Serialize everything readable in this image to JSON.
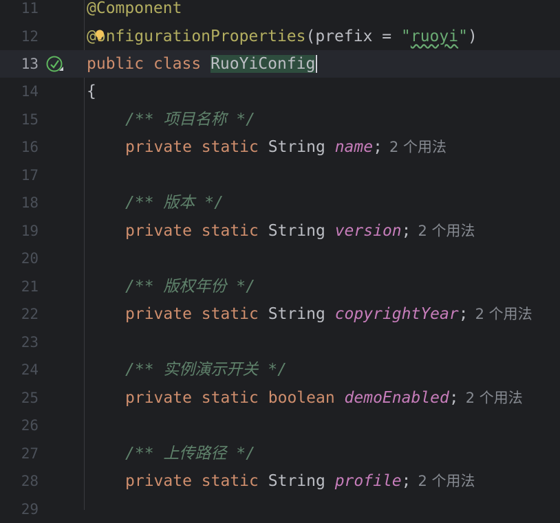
{
  "editor": {
    "hint_usages": "2 个用法",
    "lines": [
      {
        "num": "11"
      },
      {
        "num": "12"
      },
      {
        "num": "13"
      },
      {
        "num": "14"
      },
      {
        "num": "15"
      },
      {
        "num": "16"
      },
      {
        "num": "17"
      },
      {
        "num": "18"
      },
      {
        "num": "19"
      },
      {
        "num": "20"
      },
      {
        "num": "21"
      },
      {
        "num": "22"
      },
      {
        "num": "23"
      },
      {
        "num": "24"
      },
      {
        "num": "25"
      },
      {
        "num": "26"
      },
      {
        "num": "27"
      },
      {
        "num": "28"
      },
      {
        "num": "29"
      }
    ],
    "annotation_component": "@Component",
    "annotation_config_at": "@",
    "annotation_config_rest": "onfigurationProperties",
    "prefix_open": "(prefix = ",
    "prefix_value_quote_open": "\"",
    "prefix_value": "ruoyi",
    "prefix_value_quote_close": "\"",
    "prefix_close": ")",
    "kw_public": "public",
    "kw_class": "class",
    "class_name": "RuoYiConfig",
    "open_brace": "{",
    "kw_private": "private",
    "kw_static": "static",
    "type_string": "String",
    "type_boolean": "boolean",
    "semicolon": ";",
    "comment_name": "/** 项目名称 */",
    "field_name": "name",
    "comment_version": "/** 版本 */",
    "field_version": "version",
    "comment_copyright": "/** 版权年份 */",
    "field_copyright": "copyrightYear",
    "comment_demo": "/** 实例演示开关 */",
    "field_demo": "demoEnabled",
    "comment_profile": "/** 上传路径 */",
    "field_profile": "profile"
  },
  "colors": {
    "background": "#1e1f22",
    "keyword": "#cf8e6d",
    "annotation": "#b3ae60",
    "string": "#6aab73",
    "comment": "#5f826b",
    "field": "#c77dbb",
    "selection": "#2e4d3e"
  },
  "icons": {
    "gutter": "spring-bean-icon",
    "intention": "lightbulb-icon"
  }
}
